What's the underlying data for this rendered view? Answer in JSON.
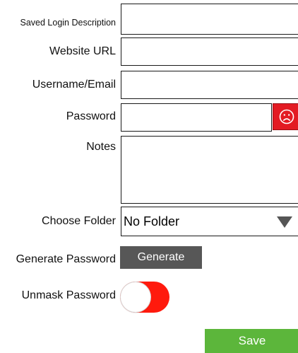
{
  "form": {
    "description": {
      "label": "Saved Login Description",
      "value": ""
    },
    "website": {
      "label": "Website URL",
      "value": ""
    },
    "username": {
      "label": "Username/Email",
      "value": ""
    },
    "password": {
      "label": "Password",
      "value": ""
    },
    "notes": {
      "label": "Notes",
      "value": ""
    },
    "folder": {
      "label": "Choose Folder",
      "selected": "No Folder"
    },
    "generate": {
      "label": "Generate Password",
      "button_label": "Generate"
    },
    "unmask": {
      "label": "Unmask Password",
      "state": "off"
    },
    "save_label": "Save"
  },
  "icons": {
    "password_strength": "sad-face-icon",
    "folder_dropdown": "triangle-down-icon"
  },
  "colors": {
    "strength_red": "#e31b23",
    "generate_gray": "#575757",
    "toggle_red": "#ff1a0d",
    "save_green": "#5cb63b"
  }
}
